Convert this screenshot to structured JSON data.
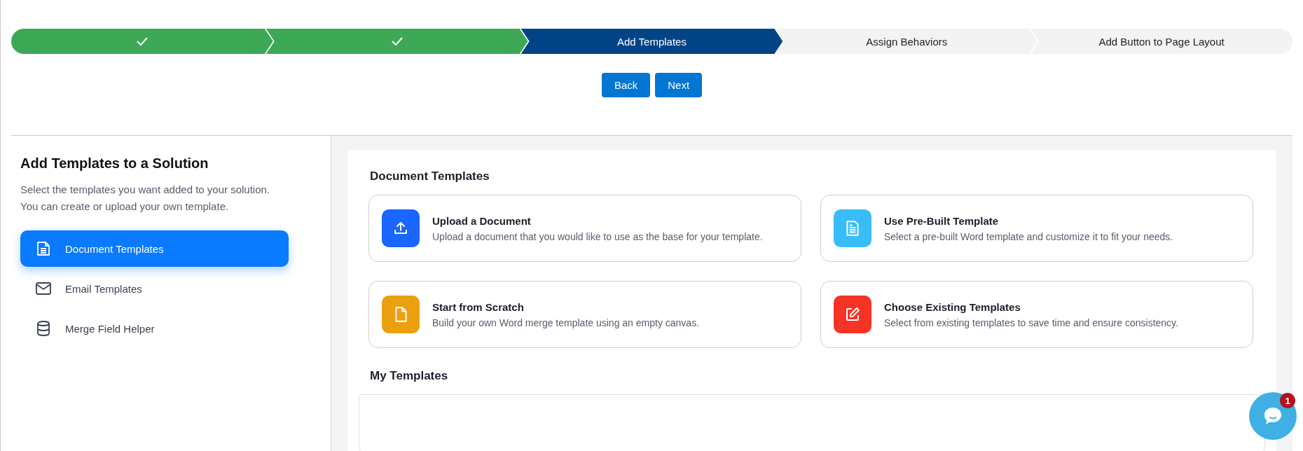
{
  "steps": [
    {
      "completed": true,
      "selected": false
    },
    {
      "completed": true,
      "selected": false
    },
    {
      "completed": false,
      "selected": true,
      "label": "Add Templates"
    },
    {
      "completed": false,
      "selected": false,
      "label": "Assign Behaviors"
    },
    {
      "completed": false,
      "selected": false,
      "label": "Add Button to Page Layout"
    }
  ],
  "buttons": [
    "Back",
    "Next"
  ],
  "sidebar": {
    "title": "Add Templates to a Solution",
    "description": "Select the templates you want added to your solution. You can create or upload your own template.",
    "items": [
      {
        "label": "Document Templates",
        "selected": true
      },
      {
        "label": "Email Templates",
        "selected": false
      },
      {
        "label": "Merge Field Helper",
        "selected": false
      }
    ]
  },
  "document_templates": {
    "title": "Document Templates",
    "cards": [
      {
        "title": "Upload a Document",
        "description": "Upload a document that you would like to use as the base for your template.",
        "color": "#1a66ff"
      },
      {
        "title": "Use Pre-Built Template",
        "description": "Select a pre-built Word template and customize it to fit your needs.",
        "color": "#38bdf8"
      },
      {
        "title": "Start from Scratch",
        "description": "Build your own Word merge template using an empty canvas.",
        "color": "#eaa00f"
      },
      {
        "title": "Choose Existing Templates",
        "description": "Select from existing templates to save time and ensure consistency.",
        "color": "#f43424"
      }
    ]
  },
  "my_templates": {
    "title": "My Templates"
  },
  "chat": {
    "badge": "1"
  }
}
